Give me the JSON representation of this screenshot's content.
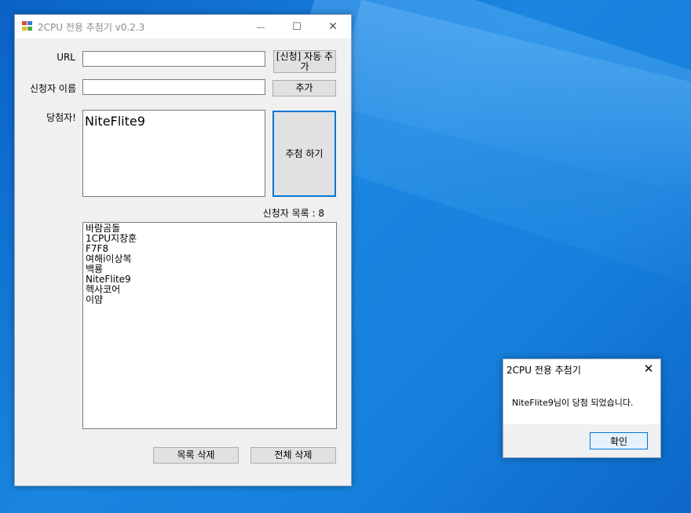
{
  "window": {
    "title": "2CPU 전용 추첨기 v0.2.3",
    "minimize_glyph": "—",
    "maximize_glyph": "☐",
    "close_glyph": "✕"
  },
  "form": {
    "url_label": "URL",
    "url_value": "",
    "auto_add_button": "[신청] 자동 추가",
    "name_label": "신청자 이름",
    "name_value": "",
    "add_button": "추가",
    "winner_label": "당첨자!",
    "winner_name": "NiteFlite9",
    "draw_button": "추첨 하기",
    "list_count_label": "신청자 목록 : 8",
    "applicants": [
      "바람곰돌",
      "1CPU지창훈",
      "F7F8",
      "여해i이상복",
      "백룡",
      "NiteFlite9",
      "헥사코어",
      "이얌"
    ],
    "delete_item_button": "목록 삭제",
    "delete_all_button": "전체 삭제"
  },
  "message_box": {
    "title": "2CPU 전용 추첨기",
    "close_glyph": "✕",
    "text": "NiteFlite9님이 당첨 되었습니다.",
    "ok_button": "확인"
  },
  "colors": {
    "desktop": "#1680dc",
    "accent": "#0078d7"
  }
}
